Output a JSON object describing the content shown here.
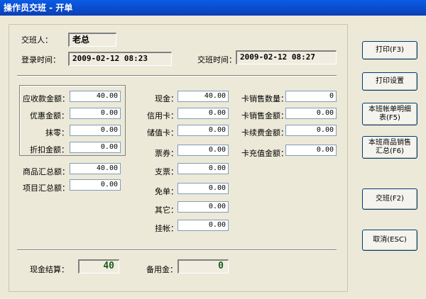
{
  "window": {
    "title": "操作员交班 - 开单"
  },
  "header": {
    "handover_person_label": "交班人：",
    "handover_person_value": "老总",
    "login_time_label": "登录时间：",
    "login_time_value": "2009-02-12 08:23",
    "handover_time_label": "交班时间：",
    "handover_time_value": "2009-02-12 08:27"
  },
  "col1": {
    "receivable_label": "应收款金额：",
    "receivable_value": "40.00",
    "discount_label": "优惠金额：",
    "discount_value": "0.00",
    "rounding_label": "抹零：",
    "rounding_value": "0.00",
    "rebate_label": "折扣金额：",
    "rebate_value": "0.00",
    "goods_total_label": "商品汇总额：",
    "goods_total_value": "40.00",
    "item_total_label": "项目汇总额：",
    "item_total_value": "0.00"
  },
  "col2": {
    "cash_label": "现金：",
    "cash_value": "40.00",
    "credit_label": "信用卡：",
    "credit_value": "0.00",
    "stored_label": "储值卡：",
    "stored_value": "0.00",
    "coupon_label": "票券：",
    "coupon_value": "0.00",
    "cheque_label": "支票：",
    "cheque_value": "0.00",
    "free_label": "免单：",
    "free_value": "0.00",
    "other_label": "其它：",
    "other_value": "0.00",
    "credit_account_label": "挂帐：",
    "credit_account_value": "0.00"
  },
  "col3": {
    "card_sales_qty_label": "卡销售数量：",
    "card_sales_qty_value": "0",
    "card_sales_amt_label": "卡销售金额：",
    "card_sales_amt_value": "0.00",
    "card_renew_label": "卡续费金额：",
    "card_renew_value": "0.00",
    "card_recharge_label": "卡充值金额：",
    "card_recharge_value": "0.00"
  },
  "footer": {
    "cash_settle_label": "现金结算：",
    "cash_settle_value": "40",
    "reserve_label": "备用金：",
    "reserve_value": "0"
  },
  "buttons": {
    "print": "打印(F3)",
    "print_settings": "打印设置",
    "shift_detail": "本班帐单明细表(F5)",
    "goods_summary": "本班商品销售汇总(F6)",
    "handover": "交班(F2)",
    "cancel": "取消(ESC)"
  },
  "colors": {
    "title_bar": "#0b4fd8",
    "window_bg": "#ece9d8",
    "value_green": "#1a5c1a"
  }
}
